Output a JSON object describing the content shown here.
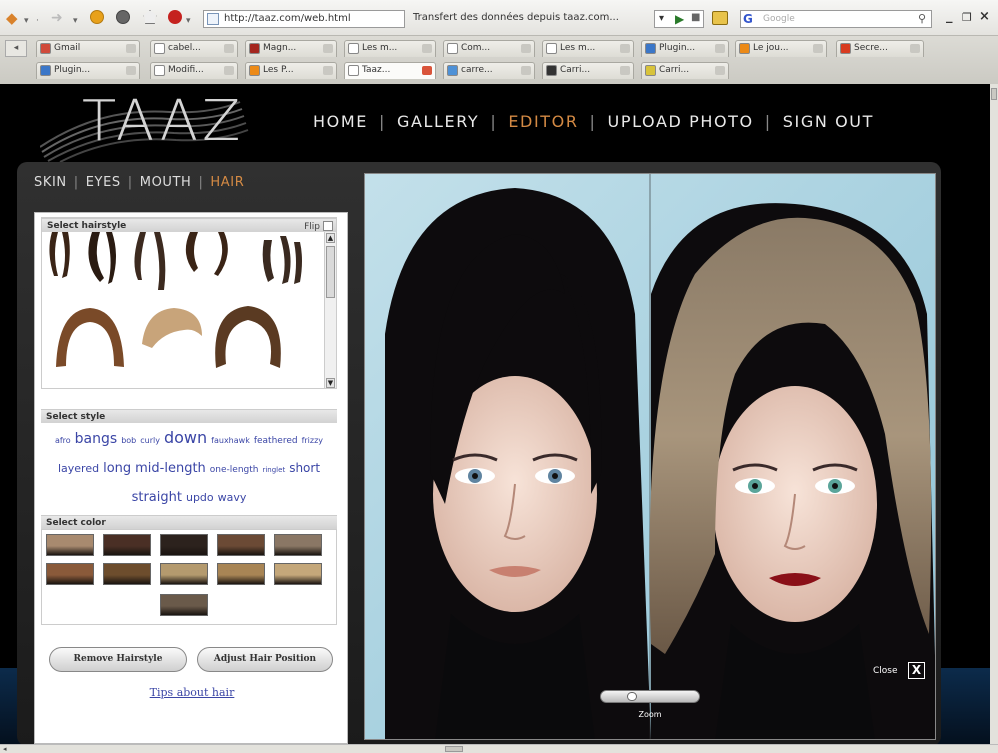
{
  "browser": {
    "url": "http://taaz.com/web.html",
    "window_title": "Transfert des données depuis taaz.com...",
    "search_engine": "G",
    "search_placeholder": "Google",
    "tabs_row1": [
      {
        "label": "Gmail",
        "icon_color": "#d04a3a",
        "has_icon": "mail-icon"
      },
      {
        "label": "cabel...",
        "icon_color": "#ffffff",
        "has_icon": "page-icon"
      },
      {
        "label": "Magn...",
        "icon_color": "#a4261f",
        "has_icon": "site-icon"
      },
      {
        "label": "Les m...",
        "icon_color": "#ffffff",
        "has_icon": "page-icon"
      },
      {
        "label": "Com...",
        "icon_color": "#ffffff",
        "has_icon": "page-icon"
      },
      {
        "label": "Les m...",
        "icon_color": "#ffffff",
        "has_icon": "page-icon"
      },
      {
        "label": "Plugin...",
        "icon_color": "#3b77c8",
        "has_icon": "plugin-icon"
      },
      {
        "label": "Le jou...",
        "icon_color": "#ec8a17",
        "has_icon": "blogger-icon"
      },
      {
        "label": "Secre...",
        "icon_color": "#d83b20",
        "has_icon": "bookmark-icon"
      }
    ],
    "tabs_row2": [
      {
        "label": "Plugin...",
        "icon_color": "#3b77c8",
        "has_icon": "plugin-icon"
      },
      {
        "label": "Modifi...",
        "icon_color": "#ffffff",
        "has_icon": "page-icon"
      },
      {
        "label": "Les P...",
        "icon_color": "#ec8a17",
        "has_icon": "blogger-icon"
      },
      {
        "label": "Taaz...",
        "icon_color": "#ffffff",
        "has_icon": "page-icon",
        "active": true
      },
      {
        "label": "carre...",
        "icon_color": "#4e91d6",
        "has_icon": "page-icon"
      },
      {
        "label": "Carri...",
        "icon_color": "#333333",
        "has_icon": "site-icon"
      },
      {
        "label": "Carri...",
        "icon_color": "#d8c33a",
        "has_icon": "site-icon"
      }
    ]
  },
  "site": {
    "logo": "TAAZ",
    "nav": [
      {
        "label": "HOME"
      },
      {
        "label": "GALLERY"
      },
      {
        "label": "EDITOR",
        "active": true
      },
      {
        "label": "UPLOAD PHOTO"
      },
      {
        "label": "SIGN OUT"
      }
    ],
    "editor_tabs": [
      {
        "label": "SKIN"
      },
      {
        "label": "EYES"
      },
      {
        "label": "MOUTH"
      },
      {
        "label": "HAIR",
        "active": true
      }
    ],
    "select_hairstyle": "Select hairstyle",
    "flip_label": "Flip",
    "select_style": "Select style",
    "styles": [
      {
        "label": "afro",
        "size": 8
      },
      {
        "label": "bangs",
        "size": 14
      },
      {
        "label": "bob",
        "size": 8
      },
      {
        "label": "curly",
        "size": 8
      },
      {
        "label": "down",
        "size": 16
      },
      {
        "label": "fauxhawk",
        "size": 8
      },
      {
        "label": "feathered",
        "size": 9
      },
      {
        "label": "frizzy",
        "size": 8
      },
      {
        "label": "layered",
        "size": 11
      },
      {
        "label": "long",
        "size": 13
      },
      {
        "label": "mid-length",
        "size": 13
      },
      {
        "label": "one-length",
        "size": 9
      },
      {
        "label": "ringlet",
        "size": 7
      },
      {
        "label": "short",
        "size": 12
      },
      {
        "label": "straight",
        "size": 13
      },
      {
        "label": "updo",
        "size": 11
      },
      {
        "label": "wavy",
        "size": 11
      }
    ],
    "select_color": "Select color",
    "swatches": [
      "#a88a6f",
      "#4a2f25",
      "#2c221d",
      "#6b4a35",
      "#8a7765",
      "#8a5a3a",
      "#6d4d2d",
      "#b49a6e",
      "#a88555",
      "#c4a77a",
      "#6a5a4a"
    ],
    "remove_button": "Remove Hairstyle",
    "adjust_button": "Adjust Hair Position",
    "tips_link": "Tips about hair",
    "close_label": "Close",
    "close_icon": "X",
    "zoom_label": "Zoom"
  }
}
